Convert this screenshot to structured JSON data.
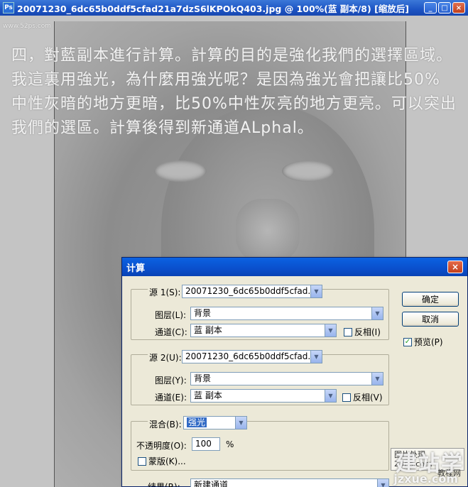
{
  "window": {
    "title": "20071230_6dc65b0ddf5cfad21a7dzS6lKPOkQ403.jpg @ 100%(蓝 副本/8) [缩放后]",
    "buttons": {
      "minimize": "_",
      "maximize": "□",
      "close": "×"
    }
  },
  "canvas": {
    "overlay_lines": [
      "四，對藍副本進行計算。計算的目的是強化我們的選擇區域。",
      "我這裏用強光，為什麼用強光呢？是因為強光會把讓比50%",
      "中性灰暗的地方更暗，比50%中性灰亮的地方更亮。可以突出",
      "我們的選區。計算後得到新通道ALphal。"
    ],
    "small_watermark": "www.52ps.com"
  },
  "dialog": {
    "title": "计算",
    "close": "×",
    "source1": {
      "label": "源 1(S):",
      "value": "20071230_6dc65b0ddf5cfad...",
      "layer_label": "图层(L):",
      "layer_value": "背景",
      "channel_label": "通道(C):",
      "channel_value": "蓝 副本",
      "invert_label": "反相(I)",
      "invert_checked": false
    },
    "source2": {
      "label": "源 2(U):",
      "value": "20071230_6dc65b0ddf5cfad...",
      "layer_label": "图层(Y):",
      "layer_value": "背景",
      "channel_label": "通道(E):",
      "channel_value": "蓝 副本",
      "invert_label": "反相(V)",
      "invert_checked": false
    },
    "blending": {
      "label": "混合(B):",
      "value": "强光",
      "opacity_label": "不透明度(O):",
      "opacity_value": "100",
      "opacity_unit": "%",
      "mask_label": "蒙版(K)...",
      "mask_checked": false
    },
    "result": {
      "label": "结果(R):",
      "value": "新建通道"
    },
    "ok_label": "确定",
    "cancel_label": "取消",
    "preview_label": "预览(P)",
    "preview_checked": true
  },
  "watermarks": {
    "big": "建站学",
    "url": "jzxue.com",
    "box_line1": "图片处理",
    "box_line2": "23ps.com",
    "box_line3": "教程网"
  }
}
